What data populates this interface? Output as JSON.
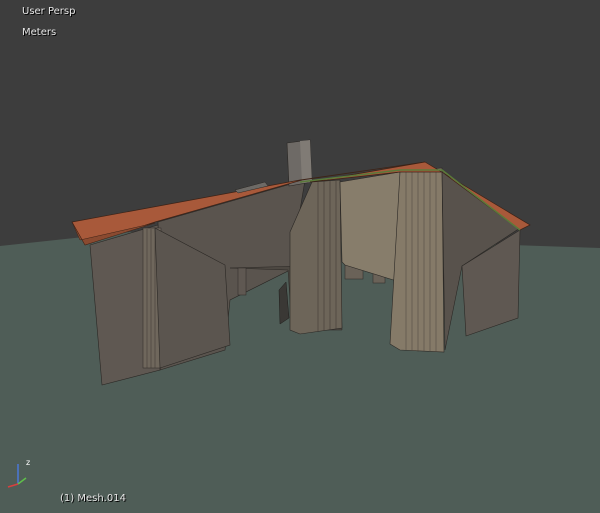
{
  "viewport": {
    "view_name": "User Persp",
    "units": "Meters",
    "object_info": "(1) Mesh.014"
  },
  "gizmo": {
    "z_label": "z",
    "x_color": "#d8403f",
    "y_color": "#5fc04a",
    "z_color": "#4a78d8"
  },
  "colors": {
    "background": "#3d3d3d",
    "ground": "#4f5d57",
    "roof": "#a8593a",
    "wall": "#5b554f",
    "wall_light": "#857a68"
  }
}
